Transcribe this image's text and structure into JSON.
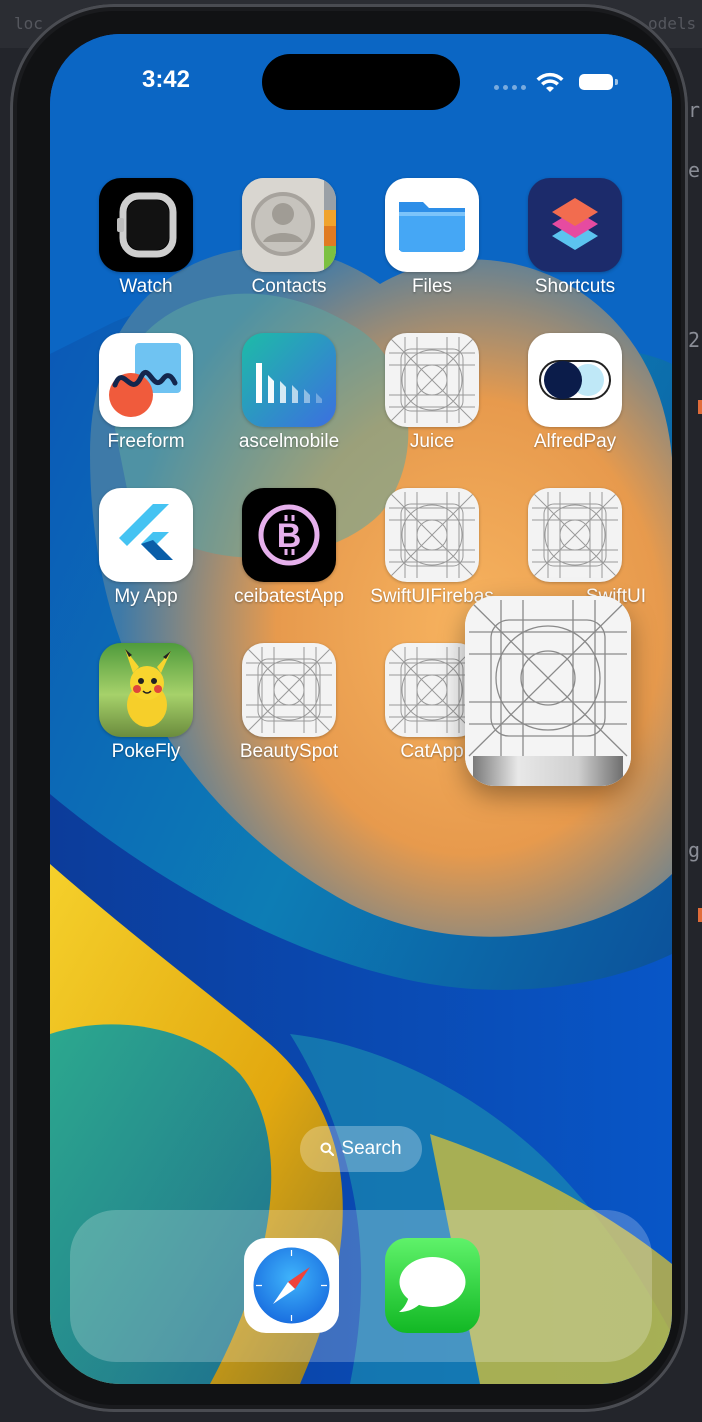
{
  "background": {
    "top_fragments": [
      "loc",
      "odels"
    ],
    "side_letters": [
      "r",
      "e",
      "2",
      "g"
    ]
  },
  "status_bar": {
    "time": "3:42",
    "wifi": "wifi-icon",
    "battery": "battery-icon"
  },
  "apps": [
    {
      "label": "Watch",
      "icon": "watch-icon"
    },
    {
      "label": "Contacts",
      "icon": "contacts-icon"
    },
    {
      "label": "Files",
      "icon": "files-folder-icon"
    },
    {
      "label": "Shortcuts",
      "icon": "shortcuts-icon"
    },
    {
      "label": "Freeform",
      "icon": "freeform-icon"
    },
    {
      "label": "ascelmobile",
      "icon": "ascelmobile-bars-icon"
    },
    {
      "label": "Juice",
      "icon": "placeholder-grid-icon"
    },
    {
      "label": "AlfredPay",
      "icon": "alfredpay-toggle-icon"
    },
    {
      "label": "My App",
      "icon": "flutter-icon"
    },
    {
      "label": "ceibatestApp",
      "icon": "bitcoin-icon"
    },
    {
      "label": "SwiftUIFirebas",
      "icon": "placeholder-grid-icon"
    },
    {
      "label": "SwiftUI",
      "icon": "placeholder-grid-icon"
    },
    {
      "label": "PokeFly",
      "icon": "pikachu-icon"
    },
    {
      "label": "BeautySpot",
      "icon": "placeholder-grid-icon"
    },
    {
      "label": "CatApp",
      "icon": "placeholder-grid-icon"
    }
  ],
  "dragged_app": {
    "icon": "placeholder-grid-icon"
  },
  "search": {
    "label": "Search"
  },
  "dock": [
    {
      "name": "Safari",
      "icon": "safari-compass-icon"
    },
    {
      "name": "Messages",
      "icon": "messages-bubble-icon"
    }
  ],
  "colors": {
    "wallpaper_blue": "#0b57c8",
    "wallpaper_orange": "#f2a34e",
    "wallpaper_yellow": "#f0c21a",
    "wallpaper_teal": "#1aa7a0"
  }
}
